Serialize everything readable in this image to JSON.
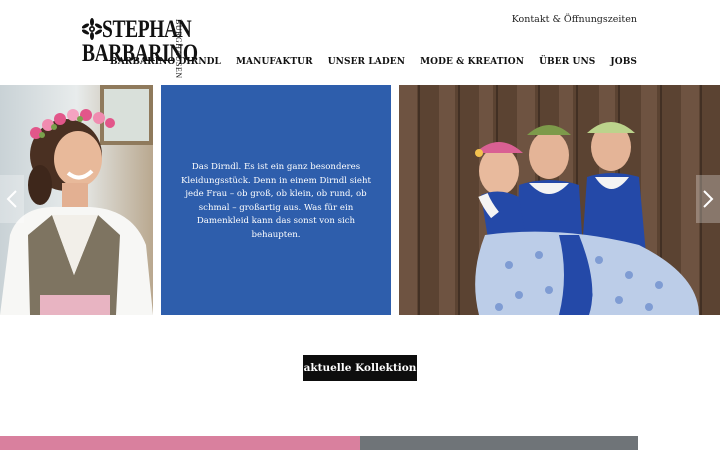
{
  "header": {
    "logo": {
      "line1": "STEPHAN",
      "line2": "BARBARINO",
      "vertical": "BURGHAUSEN"
    },
    "topbar_link": "Kontakt & Öffnungszeiten",
    "nav": [
      {
        "label": "BARBARINO DIRNDL"
      },
      {
        "label": "MANUFAKTUR"
      },
      {
        "label": "UNSER LADEN"
      },
      {
        "label": "MODE & KREATION"
      },
      {
        "label": "ÜBER UNS"
      },
      {
        "label": "JOBS"
      }
    ]
  },
  "slider": {
    "text": "Das Dirndl. Es ist ein ganz besonderes Kleidungsstück. Denn in einem Dirndl sieht jede Frau – ob groß, ob klein, ob rund, ob schmal – großartig aus. Was für ein Damenkleid kann das sonst von sich behaupten.",
    "left_icon": "chevron-left-icon",
    "right_icon": "chevron-right-icon"
  },
  "cta": {
    "label": "aktuelle Kollektion"
  },
  "colors": {
    "accent_blue": "#2e5eac",
    "button_black": "#0d0d0d",
    "pink": "#d9809e"
  }
}
